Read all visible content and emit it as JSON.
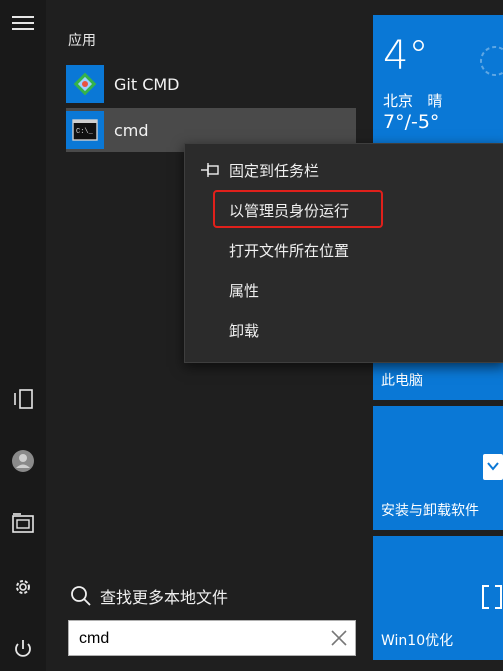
{
  "rail": {
    "menu_icon": "hamburger-icon",
    "tablet_icon": "tablet-mode-icon",
    "user_icon": "user-avatar-icon",
    "documents_icon": "documents-icon",
    "settings_icon": "gear-icon",
    "power_icon": "power-icon"
  },
  "section": {
    "label": "应用"
  },
  "apps": [
    {
      "label": "Git CMD",
      "icon": "git-cmd-icon"
    },
    {
      "label": "cmd",
      "icon": "command-prompt-icon"
    }
  ],
  "context_menu": {
    "items": [
      {
        "label": "固定到任务栏",
        "icon": "pin-icon"
      },
      {
        "label": "以管理员身份运行"
      },
      {
        "label": "打开文件所在位置"
      },
      {
        "label": "属性"
      },
      {
        "label": "卸载"
      }
    ]
  },
  "tiles": {
    "weather": {
      "temp": "4°",
      "city": "北京",
      "cond": "晴",
      "range": "7°/-5°"
    },
    "this_pc": {
      "label": "此电脑"
    },
    "install": {
      "label": "安装与卸载软件"
    },
    "win10": {
      "label": "Win10优化"
    }
  },
  "search": {
    "hint": "查找更多本地文件",
    "value": "cmd"
  },
  "colors": {
    "accent": "#0a78d6",
    "highlight_border": "#e0201b"
  }
}
